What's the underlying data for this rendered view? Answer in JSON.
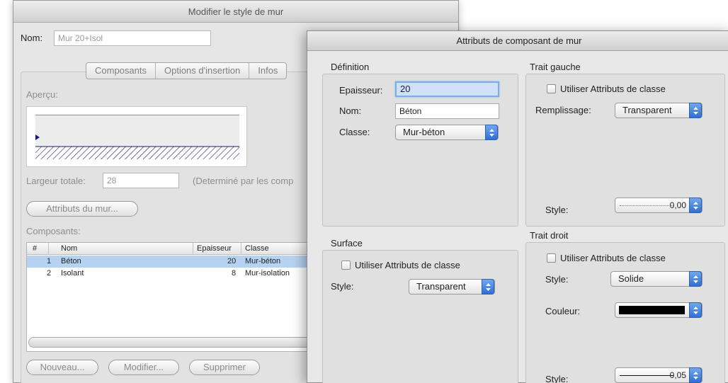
{
  "back_window": {
    "title": "Modifier le style de mur",
    "name_label": "Nom:",
    "name_value": "Mur 20+Isol",
    "tabs": [
      {
        "label": "Composants"
      },
      {
        "label": "Options d'insertion"
      },
      {
        "label": "Infos"
      }
    ],
    "preview_label": "Aperçu:",
    "total_width_label": "Largeur totale:",
    "total_width_value": "28",
    "determined_note": "(Determiné par les comp",
    "wall_attrs_button": "Attributs du mur...",
    "components_label": "Composants:",
    "table": {
      "headers": {
        "num": "#",
        "name": "Nom",
        "thickness": "Epaisseur",
        "class": "Classe"
      },
      "rows": [
        {
          "num": "1",
          "name": "Béton",
          "thickness": "20",
          "class": "Mur-béton",
          "selected": true
        },
        {
          "num": "2",
          "name": "Isolant",
          "thickness": "8",
          "class": "Mur-isolation",
          "selected": false
        }
      ]
    },
    "buttons": {
      "new": "Nouveau...",
      "modify": "Modifier...",
      "delete": "Supprimer"
    }
  },
  "front_window": {
    "title": "Attributs de composant de mur",
    "definition": {
      "title": "Définition",
      "thickness_label": "Epaisseur:",
      "thickness_value": "20",
      "name_label": "Nom:",
      "name_value": "Béton",
      "class_label": "Classe:",
      "class_value": "Mur-béton"
    },
    "left_stroke": {
      "title": "Trait gauche",
      "use_class_label": "Utiliser Attributs de classe",
      "fill_label": "Remplissage:",
      "fill_value": "Transparent",
      "style_label": "Style:",
      "style_value": "0,00"
    },
    "surface": {
      "title": "Surface",
      "use_class_label": "Utiliser Attributs de classe",
      "style_label": "Style:",
      "style_value": "Transparent"
    },
    "right_stroke": {
      "title": "Trait droit",
      "use_class_label": "Utiliser Attributs de classe",
      "style_label": "Style:",
      "style_value": "Solide",
      "color_label": "Couleur:",
      "color_value": "#000000",
      "line_style_label": "Style:",
      "line_style_value": "0,05"
    }
  },
  "colors": {
    "accent": "#3a7fe0",
    "selection": "#b6d2f2",
    "preview_line": "#1a1a6e"
  }
}
